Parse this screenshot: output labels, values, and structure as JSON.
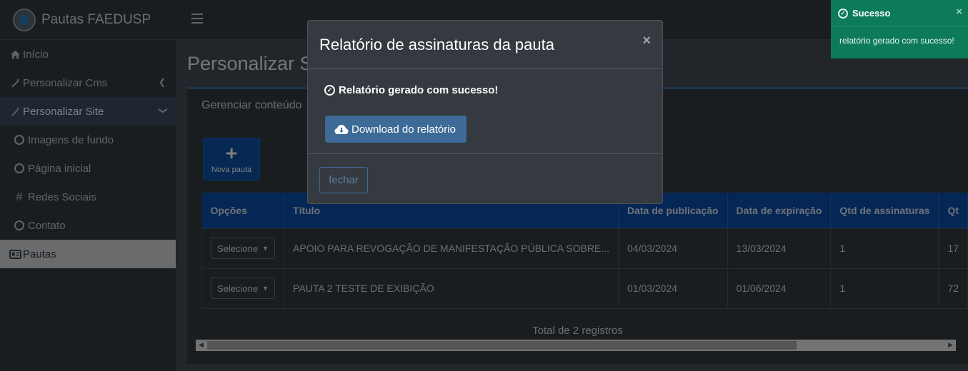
{
  "brand": {
    "title": "Pautas FAEDUSP"
  },
  "sidebar": {
    "items": [
      {
        "label": "Início",
        "icon": "home-icon"
      },
      {
        "label": "Personalizar Cms",
        "icon": "wand-icon"
      },
      {
        "label": "Personalizar Site",
        "icon": "wand-icon"
      },
      {
        "label": "Imagens de fundo",
        "icon": "circle-icon"
      },
      {
        "label": "Página inicial",
        "icon": "circle-icon"
      },
      {
        "label": "Redes Sociais",
        "icon": "hash-icon"
      },
      {
        "label": "Contato",
        "icon": "circle-icon"
      },
      {
        "label": "Pautas",
        "icon": "id-card-icon"
      }
    ]
  },
  "page": {
    "title": "Personalizar Site"
  },
  "card": {
    "title": "Gerenciar conteúdo",
    "new_button": "Nova pauta",
    "total": "Total de 2 registros"
  },
  "table": {
    "headers": [
      "Opções",
      "Título",
      "Data de publicação",
      "Data de expiração",
      "Qtd de assinaturas",
      "Qt"
    ],
    "select_label": "Selecione",
    "rows": [
      {
        "title": "APOIO PARA REVOGAÇÃO DE MANIFESTAÇÃO PÚBLICA SOBRE...",
        "pub": "04/03/2024",
        "exp": "13/03/2024",
        "qtd": "1",
        "qt": "17"
      },
      {
        "title": "PAUTA 2 TESTE DE EXIBIÇÃO",
        "pub": "01/03/2024",
        "exp": "01/06/2024",
        "qtd": "1",
        "qt": "72"
      }
    ]
  },
  "modal": {
    "title": "Relatório de assinaturas da pauta",
    "close": "×",
    "message": "Relatório gerado com sucesso!",
    "download": "Download do relatório",
    "close_button": "fechar"
  },
  "toast": {
    "title": "Sucesso",
    "body": "relatório gerado com sucesso!",
    "close": "×",
    "color": "#0d7a5a"
  }
}
